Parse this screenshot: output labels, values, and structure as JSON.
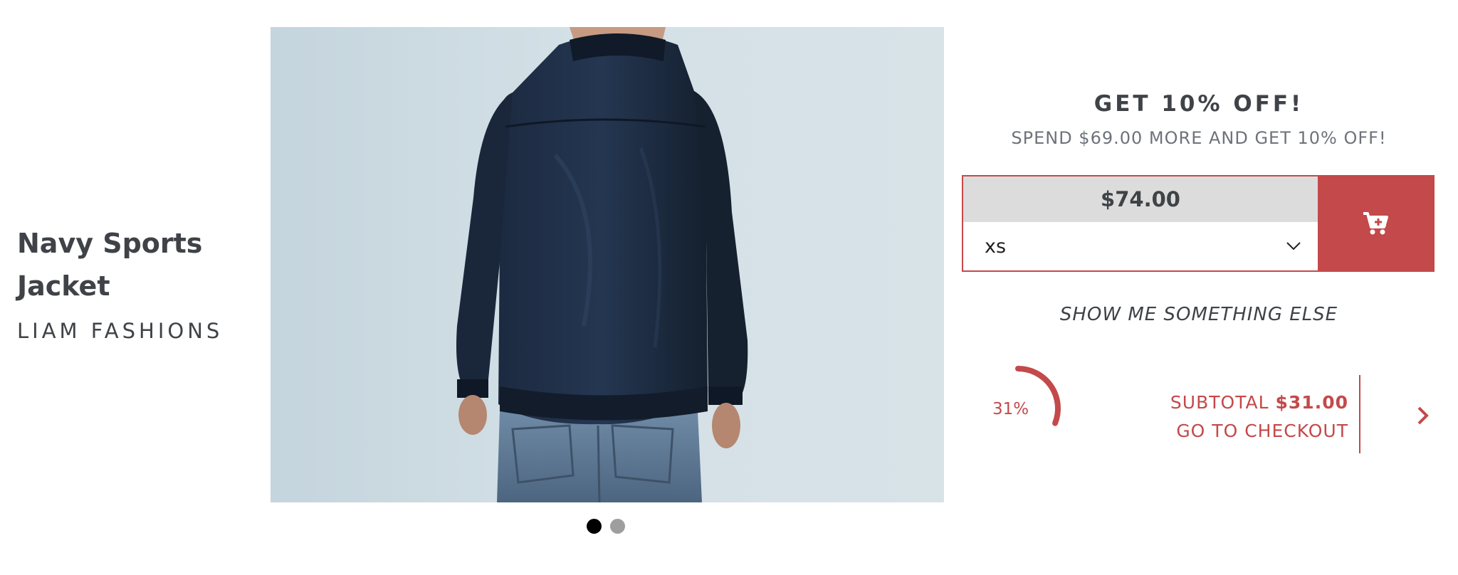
{
  "product": {
    "title": "Navy Sports Jacket",
    "brand": "LIAM FASHIONS",
    "image_alt": "Man wearing a navy sports jacket, seen from behind",
    "carousel": {
      "count": 2,
      "active_index": 0
    }
  },
  "promo": {
    "heading": "GET 10% OFF!",
    "subheading": "SPEND $69.00 MORE AND GET 10% OFF!"
  },
  "purchase": {
    "price": "$74.00",
    "size_selected": "xs",
    "cart_icon": "add-to-cart-icon"
  },
  "links": {
    "show_something_else": "SHOW ME SOMETHING ELSE"
  },
  "progress": {
    "percent": 31,
    "label": "31%"
  },
  "cart": {
    "subtotal_label": "SUBTOTAL",
    "subtotal_amount": "$31.00",
    "checkout_label": "GO TO CHECKOUT"
  },
  "colors": {
    "accent": "#c4494a",
    "text_dark": "#3f4247",
    "text_muted": "#6e737a",
    "price_bar_bg": "#dcdcdc"
  }
}
